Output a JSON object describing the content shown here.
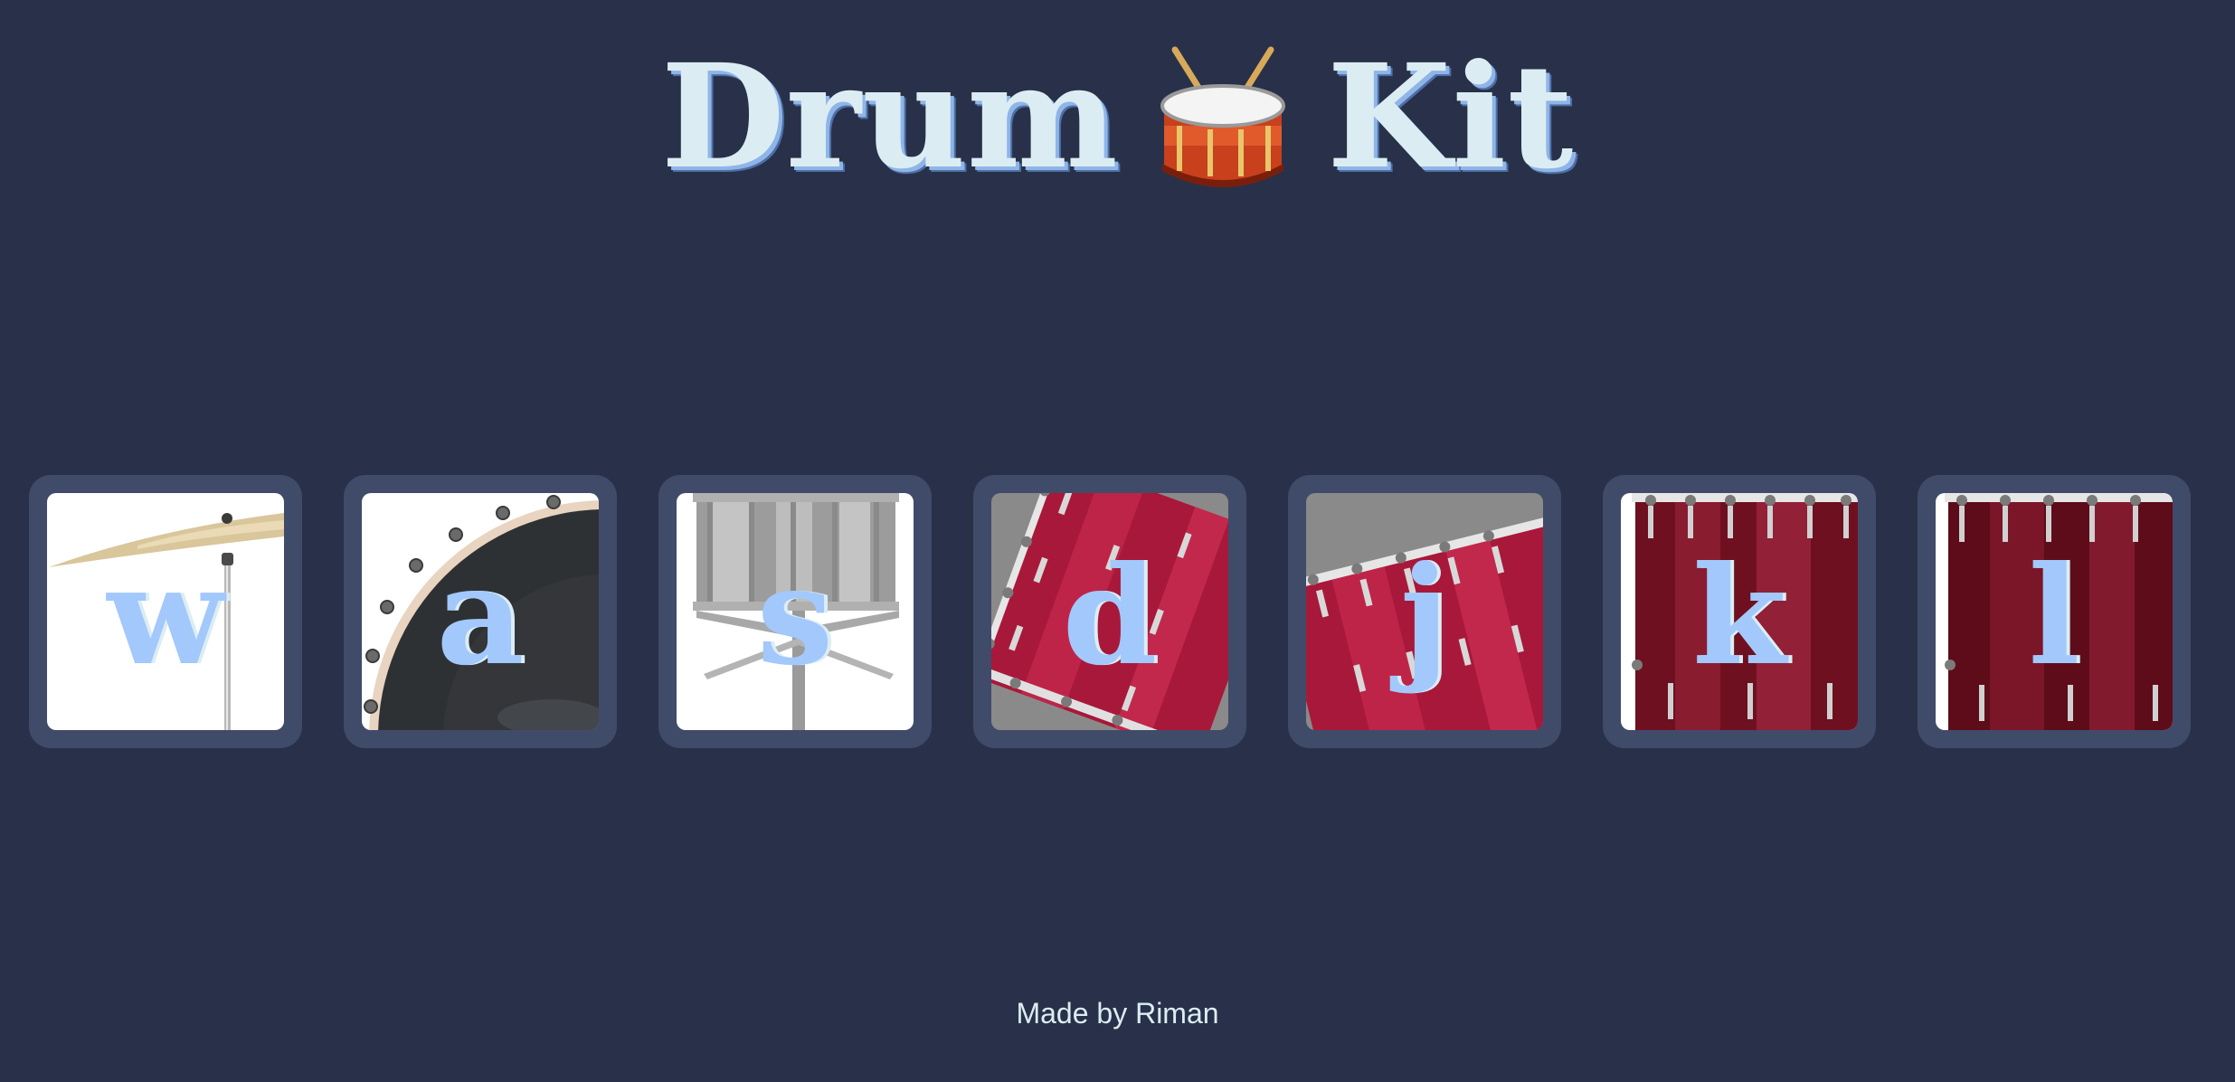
{
  "title": {
    "word1": "Drum",
    "word2": "Kit",
    "icon": "drum-icon"
  },
  "pads": [
    {
      "key": "w",
      "instrument_icon": "crash-cymbal-icon"
    },
    {
      "key": "a",
      "instrument_icon": "kick-drum-icon"
    },
    {
      "key": "s",
      "instrument_icon": "snare-drum-icon"
    },
    {
      "key": "d",
      "instrument_icon": "tom-1-icon"
    },
    {
      "key": "j",
      "instrument_icon": "tom-2-icon"
    },
    {
      "key": "k",
      "instrument_icon": "tom-3-icon"
    },
    {
      "key": "l",
      "instrument_icon": "tom-4-icon"
    }
  ],
  "footer": {
    "text": "Made by Riman"
  },
  "colors": {
    "background": "#283149",
    "pad_frame": "#404B69",
    "title": "#DBEDF3",
    "letter": "#A2C8FC"
  }
}
